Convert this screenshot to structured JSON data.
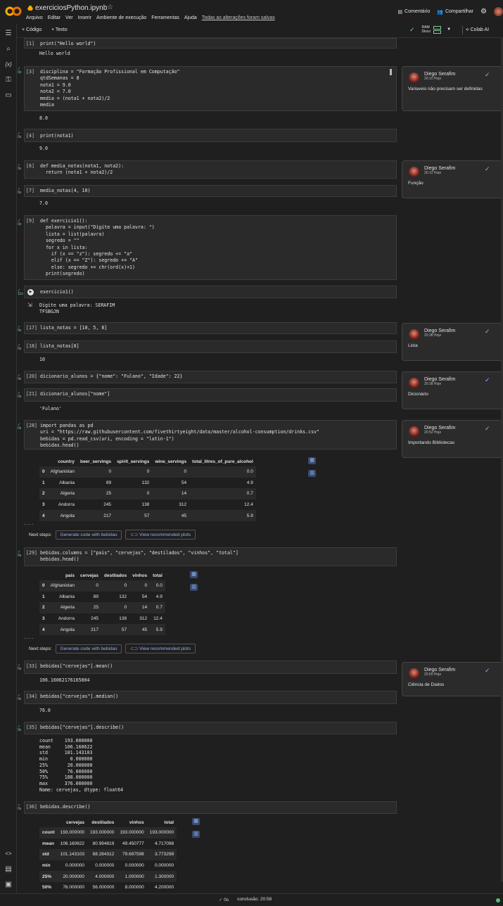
{
  "app": {
    "file_name": "exerciciosPython.ipynb",
    "menu": [
      "Arquivo",
      "Editar",
      "Ver",
      "Inserir",
      "Ambiente de execução",
      "Ferramentas",
      "Ajuda"
    ],
    "saved_status": "Todas as alterações foram salvas",
    "comment_btn": "Comentário",
    "share_btn": "Compartilhar"
  },
  "toolbar": {
    "add_code": "+ Código",
    "add_text": "+ Texto",
    "ram": "RAM",
    "disk": "Disco",
    "colab_ai": "Colab AI"
  },
  "cells": {
    "c1": {
      "n": "[1]",
      "code": "print(\"Hello world\")",
      "out": "Hello world"
    },
    "c3": {
      "n": "[3]",
      "code": "disciplina = \"Formação Profissional em Computação\"\nqtdSemanas = 8\nnota1 = 9.0\nnota2 = 7.0\nmedia = (nota1 + nota2)/2\nmedia",
      "out": "8.0"
    },
    "c4": {
      "n": "[4]",
      "code": "print(nota1)",
      "out": "9.0"
    },
    "c6": {
      "n": "[6]",
      "code": "def media_notas(nota1, nota2):\n  return (nota1 + nota2)/2"
    },
    "c7": {
      "n": "[7]",
      "code": "media_notas(4, 10)",
      "out": "7.0"
    },
    "c9": {
      "n": "[9]",
      "code": "def exercicio1():\n  palavra = input(\"Digite uma palavra: \")\n  lista = list(palavra)\n  segredo = \"\"\n  for x in lista:\n    if (x == \"z\"): segredo += \"a\"\n    elif (x == \"Z\"): segredo += \"A\"\n    else: segredo += chr(ord(x)+1)\n  print(segredo)"
    },
    "cex": {
      "code": "exercicio1()",
      "out": "Digite uma palavra: SERAFIM\nTFSBGJN",
      "gutter": "11s"
    },
    "c17": {
      "n": "[17]",
      "code": "lista_notas = [10, 5, 8]"
    },
    "c18": {
      "n": "[18]",
      "code": "lista_notas[0]",
      "out": "10"
    },
    "c20": {
      "n": "[20]",
      "code": "dicionario_alunos = {\"nome\": \"Fulano\", \"Idade\": 22}"
    },
    "c21": {
      "n": "[21]",
      "code": "dicionario_alunos[\"nome\"]",
      "out": "'Fulano'"
    },
    "c28": {
      "n": "[28]",
      "code": "import pandas as pd\nuri = \"https://raw.githubusercontent.com/fivethirtyeight/data/master/alcohol-consumption/drinks.csv\"\nbebidas = pd.read_csv(uri, encoding = \"latin-1\")\nbebidas.head()"
    },
    "c29": {
      "n": "[29]",
      "code": "bebidas.columns = [\"pais\", \"cervejas\", \"destilados\", \"vinhos\", \"total\"]\nbebidas.head()"
    },
    "c33": {
      "n": "[33]",
      "code": "bebidas[\"cervejas\"].mean()",
      "out": "106.16062176165804"
    },
    "c34": {
      "n": "[34]",
      "code": "bebidas[\"cervejas\"].median()",
      "out": "76.0"
    },
    "c35": {
      "n": "[35]",
      "code": "bebidas[\"cervejas\"].describe()",
      "out": "count    193.000000\nmean     106.160622\nstd      101.143103\nmin        0.000000\n25%       20.000000\n50%       76.000000\n75%      188.000000\nmax      376.000000\nName: cervejas, dtype: float64"
    },
    "c36": {
      "n": "[36]",
      "code": "bebidas.describe()"
    }
  },
  "df1": {
    "columns": [
      "",
      "country",
      "beer_servings",
      "spirit_servings",
      "wine_servings",
      "total_litres_of_pure_alcohol"
    ],
    "rows": [
      [
        "0",
        "Afghanistan",
        "0",
        "0",
        "0",
        "0.0"
      ],
      [
        "1",
        "Albania",
        "89",
        "132",
        "54",
        "4.9"
      ],
      [
        "2",
        "Algeria",
        "25",
        "0",
        "14",
        "0.7"
      ],
      [
        "3",
        "Andorra",
        "245",
        "138",
        "312",
        "12.4"
      ],
      [
        "4",
        "Angola",
        "217",
        "57",
        "45",
        "5.9"
      ]
    ]
  },
  "df2": {
    "columns": [
      "",
      "pais",
      "cervejas",
      "destilados",
      "vinhos",
      "total"
    ],
    "rows": [
      [
        "0",
        "Afghanistan",
        "0",
        "0",
        "0",
        "0.0"
      ],
      [
        "1",
        "Albania",
        "89",
        "132",
        "54",
        "4.9"
      ],
      [
        "2",
        "Algeria",
        "25",
        "0",
        "14",
        "0.7"
      ],
      [
        "3",
        "Andorra",
        "245",
        "138",
        "312",
        "12.4"
      ],
      [
        "4",
        "Angola",
        "217",
        "57",
        "45",
        "5.9"
      ]
    ]
  },
  "df3": {
    "columns": [
      "",
      "cervejas",
      "destilados",
      "vinhos",
      "total"
    ],
    "rows": [
      [
        "count",
        "193.000000",
        "193.000000",
        "193.000000",
        "193.000000"
      ],
      [
        "mean",
        "106.160622",
        "80.994819",
        "49.450777",
        "4.717098"
      ],
      [
        "std",
        "101.143103",
        "88.284312",
        "79.697598",
        "3.773298"
      ],
      [
        "min",
        "0.000000",
        "0.000000",
        "0.000000",
        "0.000000"
      ],
      [
        "25%",
        "20.000000",
        "4.000000",
        "1.000000",
        "1.300000"
      ],
      [
        "50%",
        "76.000000",
        "56.000000",
        "8.000000",
        "4.200000"
      ]
    ]
  },
  "next_steps": {
    "label": "Next steps:",
    "gen1": "Generate code with bebidas",
    "view": "View recommended plots"
  },
  "comments": [
    {
      "name": "Diego Serafim",
      "time": "20:10 Hoje",
      "text": "Variaveis não precisam ser definidas"
    },
    {
      "name": "Diego Serafim",
      "time": "20:12 Hoje",
      "text": "Função"
    },
    {
      "name": "Diego Serafim",
      "time": "20:38 Hoje",
      "text": "Lista"
    },
    {
      "name": "Diego Serafim",
      "time": "20:38 Hoje",
      "text": "Dicionário"
    },
    {
      "name": "Diego Serafim",
      "time": "20:52 Hoje",
      "text": "Importando Bibliotecas"
    },
    {
      "name": "Diego Serafim",
      "time": "20:55 Hoje",
      "text": "Ciência de Dados"
    }
  ],
  "status": {
    "exec_time": "0s",
    "completed": "conclusão: 20:58"
  }
}
